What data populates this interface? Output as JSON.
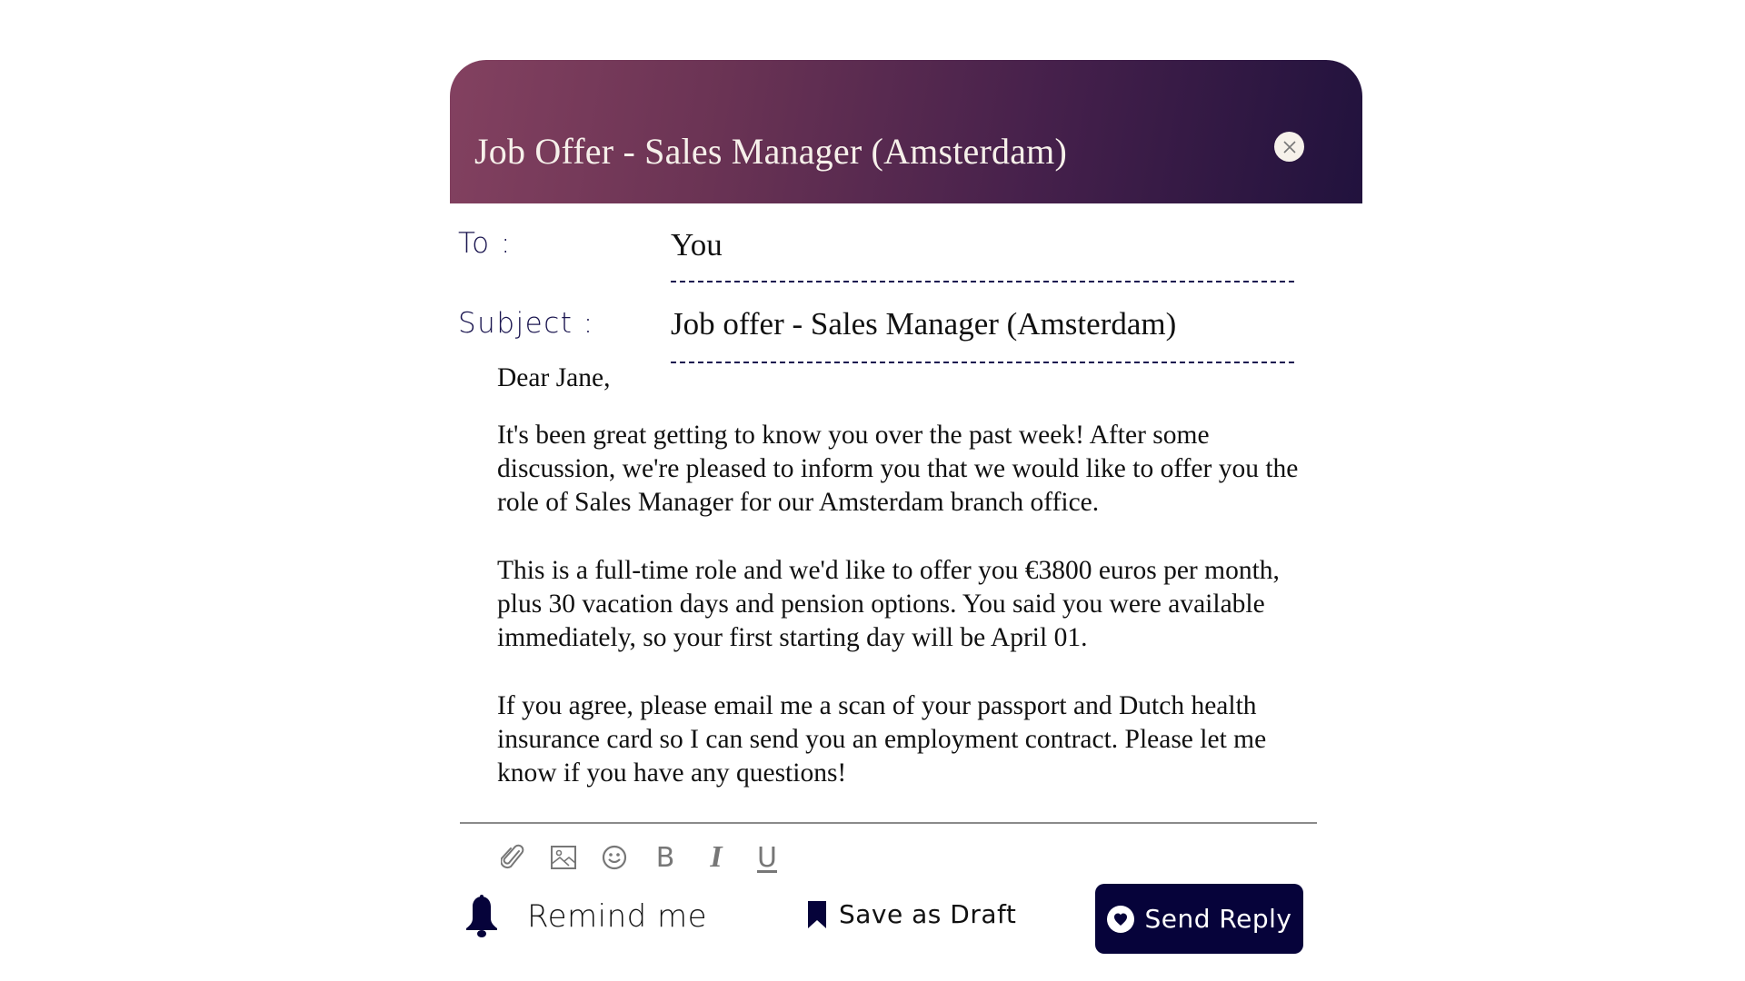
{
  "header": {
    "title": "Job Offer - Sales Manager (Amsterdam)",
    "close_icon": "close-icon",
    "gradient_start": "#834160",
    "gradient_end": "#21123d"
  },
  "fields": {
    "to_label": "To :",
    "to_value": "You",
    "subject_label": "Subject :",
    "subject_value": "Job offer - Sales Manager (Amsterdam)"
  },
  "message": {
    "greeting": "Dear Jane,",
    "paragraphs": [
      "It's been great getting to know you over the past week! After some discussion, we're pleased to inform you that we would like to offer you the role of Sales Manager for our Amsterdam branch office.",
      "This is a full-time role and we'd like to offer you €3800 euros per month, plus 30 vacation days and pension options. You said you were available immediately, so your first starting day will be April 01.",
      "If you agree, please email me a scan of your passport and Dutch health insurance card so I can send you an employment contract. Please let me know if you have any questions!"
    ]
  },
  "toolbar": {
    "items": [
      {
        "name": "attach",
        "icon": "paperclip-icon"
      },
      {
        "name": "image",
        "icon": "image-icon"
      },
      {
        "name": "emoji",
        "icon": "smiley-icon"
      },
      {
        "name": "bold",
        "label": "B"
      },
      {
        "name": "italic",
        "label": "I"
      },
      {
        "name": "underline",
        "label": "U"
      }
    ]
  },
  "actions": {
    "remind_label": "Remind me",
    "remind_icon": "bell-icon",
    "draft_label": "Save as Draft",
    "draft_icon": "bookmark-icon",
    "send_label": "Send Reply",
    "send_icon": "heart-icon",
    "send_color": "#06033a"
  }
}
